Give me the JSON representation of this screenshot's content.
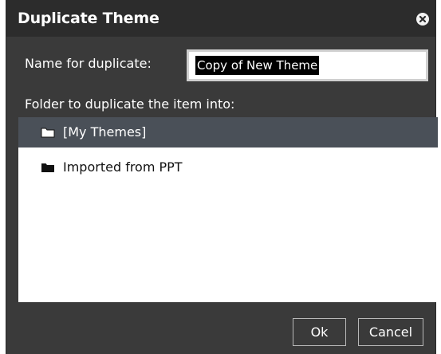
{
  "dialog": {
    "title": "Duplicate Theme",
    "name_label": "Name for duplicate:",
    "name_value": "Copy of New Theme",
    "folder_label": "Folder to duplicate the item into:",
    "folders": [
      {
        "label": "[My Themes]",
        "selected": true
      },
      {
        "label": "Imported from PPT",
        "selected": false
      }
    ],
    "ok_label": "Ok",
    "cancel_label": "Cancel"
  },
  "icons": {
    "close": "close-icon",
    "folder": "folder-icon"
  },
  "colors": {
    "dialog_bg": "#3a3a3a",
    "titlebar_bg": "#2c2c2c",
    "selected_row": "#4a5058",
    "text": "#ffffff"
  }
}
